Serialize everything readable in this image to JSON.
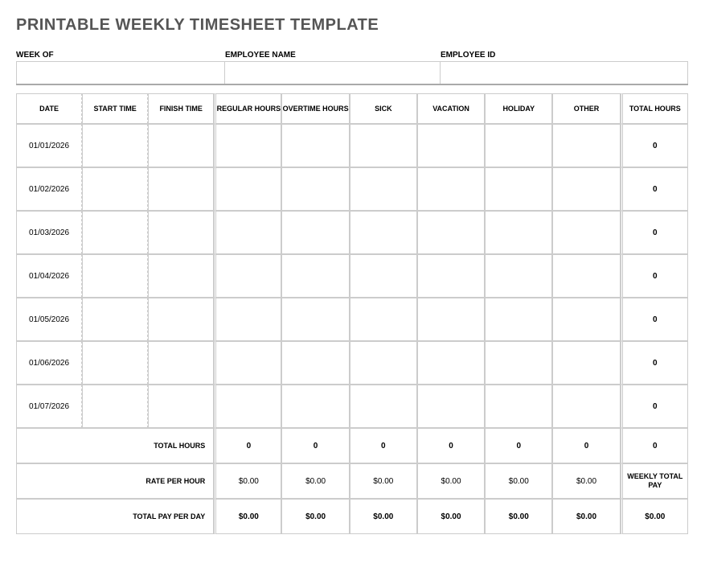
{
  "title": "PRINTABLE WEEKLY TIMESHEET TEMPLATE",
  "info": {
    "week_label": "WEEK OF",
    "week_value": "",
    "name_label": "EMPLOYEE NAME",
    "name_value": "",
    "id_label": "EMPLOYEE ID",
    "id_value": ""
  },
  "headers": {
    "date": "DATE",
    "start": "START TIME",
    "finish": "FINISH TIME",
    "regular": "REGULAR HOURS",
    "overtime": "OVERTIME HOURS",
    "sick": "SICK",
    "vacation": "VACATION",
    "holiday": "HOLIDAY",
    "other": "OTHER",
    "total": "TOTAL HOURS"
  },
  "rows": [
    {
      "date": "01/01/2026",
      "total": "0"
    },
    {
      "date": "01/02/2026",
      "total": "0"
    },
    {
      "date": "01/03/2026",
      "total": "0"
    },
    {
      "date": "01/04/2026",
      "total": "0"
    },
    {
      "date": "01/05/2026",
      "total": "0"
    },
    {
      "date": "01/06/2026",
      "total": "0"
    },
    {
      "date": "01/07/2026",
      "total": "0"
    }
  ],
  "summary": {
    "total_hours_label": "TOTAL HOURS",
    "total_hours": {
      "regular": "0",
      "overtime": "0",
      "sick": "0",
      "vacation": "0",
      "holiday": "0",
      "other": "0",
      "grand": "0"
    },
    "rate_label": "RATE PER HOUR",
    "rate": {
      "regular": "$0.00",
      "overtime": "$0.00",
      "sick": "$0.00",
      "vacation": "$0.00",
      "holiday": "$0.00",
      "other": "$0.00"
    },
    "weekly_pay_label": "WEEKLY TOTAL PAY",
    "pay_label": "TOTAL PAY PER DAY",
    "pay": {
      "regular": "$0.00",
      "overtime": "$0.00",
      "sick": "$0.00",
      "vacation": "$0.00",
      "holiday": "$0.00",
      "other": "$0.00",
      "grand": "$0.00"
    }
  }
}
